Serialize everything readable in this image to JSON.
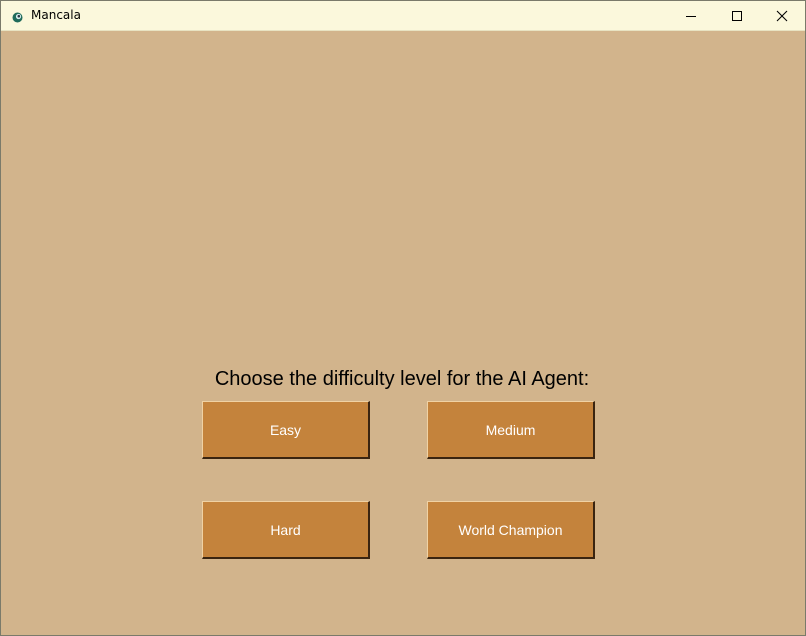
{
  "window": {
    "title": "Mancala",
    "icon": "mancala-app-icon",
    "controls": {
      "minimize": "minimize-icon",
      "maximize": "maximize-icon",
      "close": "close-icon"
    }
  },
  "colors": {
    "titlebar": "#fbf8dc",
    "background": "#d2b48c",
    "button": "#c4833c",
    "button_text": "#ffffff"
  },
  "main": {
    "prompt": "Choose the difficulty level for the AI Agent:",
    "buttons": [
      {
        "label": "Easy"
      },
      {
        "label": "Medium"
      },
      {
        "label": "Hard"
      },
      {
        "label": "World Champion"
      }
    ]
  }
}
